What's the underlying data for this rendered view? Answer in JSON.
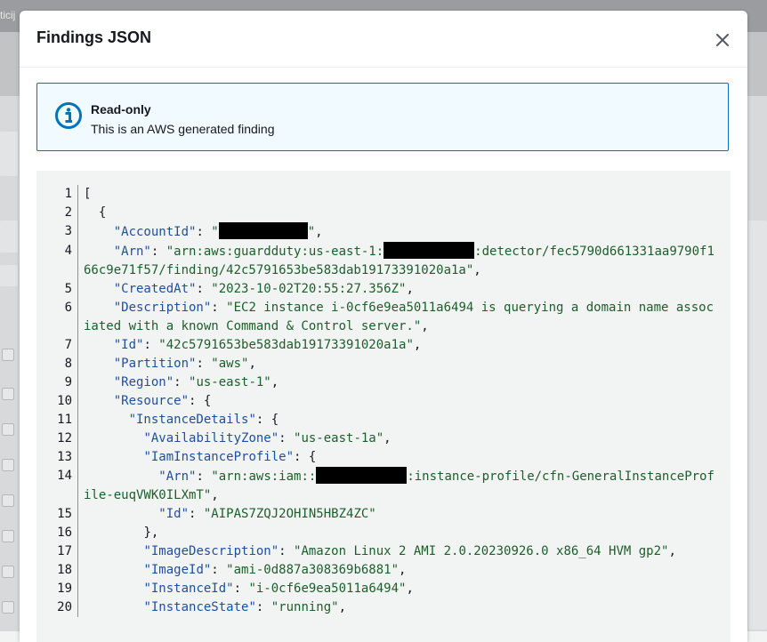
{
  "background": {
    "tab_fragment": "ticij"
  },
  "modal": {
    "title": "Findings JSON"
  },
  "alert": {
    "icon": "info-icon",
    "title": "Read-only",
    "text": "This is an AWS generated finding"
  },
  "code": {
    "lines": [
      {
        "n": "1",
        "parts": [
          {
            "t": "p",
            "v": "["
          }
        ]
      },
      {
        "n": "2",
        "parts": [
          {
            "t": "p",
            "v": "  {"
          }
        ]
      },
      {
        "n": "3",
        "parts": [
          {
            "t": "p",
            "v": "    "
          },
          {
            "t": "k",
            "v": "\"AccountId\""
          },
          {
            "t": "p",
            "v": ": "
          },
          {
            "t": "s",
            "v": "\""
          },
          {
            "t": "r",
            "w": 100
          },
          {
            "t": "s",
            "v": "\""
          },
          {
            "t": "p",
            "v": ","
          }
        ]
      },
      {
        "n": "4",
        "parts": [
          {
            "t": "p",
            "v": "    "
          },
          {
            "t": "k",
            "v": "\"Arn\""
          },
          {
            "t": "p",
            "v": ": "
          },
          {
            "t": "s",
            "v": "\"arn:aws:guardduty:us-east-1:"
          },
          {
            "t": "r",
            "w": 102
          },
          {
            "t": "s",
            "v": ":detector/fec5790d661331aa9790f166c9e71f57/finding/42c5791653be583dab19173391020a1a\""
          },
          {
            "t": "p",
            "v": ","
          }
        ]
      },
      {
        "n": "5",
        "parts": [
          {
            "t": "p",
            "v": "    "
          },
          {
            "t": "k",
            "v": "\"CreatedAt\""
          },
          {
            "t": "p",
            "v": ": "
          },
          {
            "t": "s",
            "v": "\"2023-10-02T20:55:27.356Z\""
          },
          {
            "t": "p",
            "v": ","
          }
        ]
      },
      {
        "n": "6",
        "parts": [
          {
            "t": "p",
            "v": "    "
          },
          {
            "t": "k",
            "v": "\"Description\""
          },
          {
            "t": "p",
            "v": ": "
          },
          {
            "t": "s",
            "v": "\"EC2 instance i-0cf6e9ea5011a6494 is querying a domain name associated with a known Command & Control server.\""
          },
          {
            "t": "p",
            "v": ","
          }
        ]
      },
      {
        "n": "7",
        "parts": [
          {
            "t": "p",
            "v": "    "
          },
          {
            "t": "k",
            "v": "\"Id\""
          },
          {
            "t": "p",
            "v": ": "
          },
          {
            "t": "s",
            "v": "\"42c5791653be583dab19173391020a1a\""
          },
          {
            "t": "p",
            "v": ","
          }
        ]
      },
      {
        "n": "8",
        "parts": [
          {
            "t": "p",
            "v": "    "
          },
          {
            "t": "k",
            "v": "\"Partition\""
          },
          {
            "t": "p",
            "v": ": "
          },
          {
            "t": "s",
            "v": "\"aws\""
          },
          {
            "t": "p",
            "v": ","
          }
        ]
      },
      {
        "n": "9",
        "parts": [
          {
            "t": "p",
            "v": "    "
          },
          {
            "t": "k",
            "v": "\"Region\""
          },
          {
            "t": "p",
            "v": ": "
          },
          {
            "t": "s",
            "v": "\"us-east-1\""
          },
          {
            "t": "p",
            "v": ","
          }
        ]
      },
      {
        "n": "10",
        "parts": [
          {
            "t": "p",
            "v": "    "
          },
          {
            "t": "k",
            "v": "\"Resource\""
          },
          {
            "t": "p",
            "v": ": {"
          }
        ]
      },
      {
        "n": "11",
        "parts": [
          {
            "t": "p",
            "v": "      "
          },
          {
            "t": "k",
            "v": "\"InstanceDetails\""
          },
          {
            "t": "p",
            "v": ": {"
          }
        ]
      },
      {
        "n": "12",
        "parts": [
          {
            "t": "p",
            "v": "        "
          },
          {
            "t": "k",
            "v": "\"AvailabilityZone\""
          },
          {
            "t": "p",
            "v": ": "
          },
          {
            "t": "s",
            "v": "\"us-east-1a\""
          },
          {
            "t": "p",
            "v": ","
          }
        ]
      },
      {
        "n": "13",
        "parts": [
          {
            "t": "p",
            "v": "        "
          },
          {
            "t": "k",
            "v": "\"IamInstanceProfile\""
          },
          {
            "t": "p",
            "v": ": {"
          }
        ]
      },
      {
        "n": "14",
        "parts": [
          {
            "t": "p",
            "v": "          "
          },
          {
            "t": "k",
            "v": "\"Arn\""
          },
          {
            "t": "p",
            "v": ": "
          },
          {
            "t": "s",
            "v": "\"arn:aws:iam::"
          },
          {
            "t": "r",
            "w": 102
          },
          {
            "t": "s",
            "v": ":instance-profile/cfn-GeneralInstanceProfile-euqVWK0ILXmT\""
          },
          {
            "t": "p",
            "v": ","
          }
        ]
      },
      {
        "n": "15",
        "parts": [
          {
            "t": "p",
            "v": "          "
          },
          {
            "t": "k",
            "v": "\"Id\""
          },
          {
            "t": "p",
            "v": ": "
          },
          {
            "t": "s",
            "v": "\"AIPAS7ZQJ2OHIN5HBZ4ZC\""
          }
        ]
      },
      {
        "n": "16",
        "parts": [
          {
            "t": "p",
            "v": "        },"
          }
        ]
      },
      {
        "n": "17",
        "parts": [
          {
            "t": "p",
            "v": "        "
          },
          {
            "t": "k",
            "v": "\"ImageDescription\""
          },
          {
            "t": "p",
            "v": ": "
          },
          {
            "t": "s",
            "v": "\"Amazon Linux 2 AMI 2.0.20230926.0 x86_64 HVM gp2\""
          },
          {
            "t": "p",
            "v": ","
          }
        ]
      },
      {
        "n": "18",
        "parts": [
          {
            "t": "p",
            "v": "        "
          },
          {
            "t": "k",
            "v": "\"ImageId\""
          },
          {
            "t": "p",
            "v": ": "
          },
          {
            "t": "s",
            "v": "\"ami-0d887a308369b6881\""
          },
          {
            "t": "p",
            "v": ","
          }
        ]
      },
      {
        "n": "19",
        "parts": [
          {
            "t": "p",
            "v": "        "
          },
          {
            "t": "k",
            "v": "\"InstanceId\""
          },
          {
            "t": "p",
            "v": ": "
          },
          {
            "t": "s",
            "v": "\"i-0cf6e9ea5011a6494\""
          },
          {
            "t": "p",
            "v": ","
          }
        ]
      },
      {
        "n": "20",
        "parts": [
          {
            "t": "p",
            "v": "        "
          },
          {
            "t": "k",
            "v": "\"InstanceState\""
          },
          {
            "t": "p",
            "v": ": "
          },
          {
            "t": "s",
            "v": "\"running\""
          },
          {
            "t": "p",
            "v": ","
          }
        ]
      }
    ]
  },
  "colors": {
    "key": "#1f4f9c",
    "string": "#1d5e2b",
    "alert_border": "#0073bb",
    "alert_bg": "#f1faff",
    "code_bg": "#f2f3f3"
  }
}
